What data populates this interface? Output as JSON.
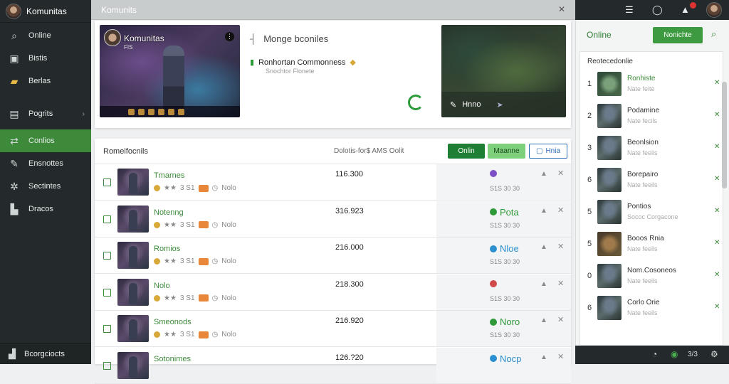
{
  "sidebar": {
    "title": "Komunitas",
    "items": [
      {
        "label": "Online",
        "icon": "search-icon"
      },
      {
        "label": "Bistis",
        "icon": "square-icon"
      },
      {
        "label": "Berlas",
        "icon": "folder-icon"
      },
      {
        "label": "Pogrits",
        "icon": "list-icon"
      },
      {
        "label": "Conlios",
        "icon": "share-icon"
      },
      {
        "label": "Ensnottes",
        "icon": "pen-icon"
      },
      {
        "label": "Sectintes",
        "icon": "gear-icon"
      },
      {
        "label": "Dracos",
        "icon": "chart-icon"
      }
    ],
    "bottom": {
      "label": "Bcorgciocts",
      "icon": "people-icon"
    }
  },
  "topbar": {
    "title": "Komunits"
  },
  "featured": {
    "thumb_title": "Komunitas",
    "thumb_sub": "FIS",
    "heading": "Monge bconiles",
    "stream_title": "Ronhortan Commonness",
    "stream_sub": "Snochtor Flonete",
    "map_label": "Hnno"
  },
  "list": {
    "title": "Romeifocnils",
    "count": "Dolotis-for$ AMS Oolit",
    "buttons": {
      "online": "Onlin",
      "manage": "Maanne",
      "more": "Hnia"
    },
    "rows": [
      {
        "name": "Tmarnes",
        "meta": "3 S1",
        "tag": "Nolo",
        "score": "116.300",
        "status": "",
        "status_color": "#7b4fc7",
        "sub": "S1S 30 30"
      },
      {
        "name": "Notenng",
        "meta": "3 S1",
        "tag": "Nolo",
        "score": "316.923",
        "status": "Pota",
        "status_color": "#2e9a3a",
        "sub": "S1S 30 30"
      },
      {
        "name": "Romios",
        "meta": "3 S1",
        "tag": "Nolo",
        "score": "216.000",
        "status": "Nloe",
        "status_color": "#2b8fd0",
        "sub": "S1S 30 30"
      },
      {
        "name": "Nolo",
        "meta": "3 S1",
        "tag": "Nolo",
        "score": "218.300",
        "status": "",
        "status_color": "#d04a4a",
        "sub": "S1S 30 30"
      },
      {
        "name": "Smeonods",
        "meta": "3 S1",
        "tag": "Nolo",
        "score": "216.920",
        "status": "Noro",
        "status_color": "#2e9a3a",
        "sub": "S1S 30 30"
      },
      {
        "name": "Sotonimes",
        "meta": "",
        "tag": "",
        "score": "126.?20",
        "status": "Nocp",
        "status_color": "#2b8fd0",
        "sub": ""
      }
    ]
  },
  "rightpanel": {
    "online_label": "Online",
    "button": "Nonichte",
    "list_title": "Reotecedonlie",
    "items": [
      {
        "num": "1",
        "title": "Ronhiste",
        "sub": "Nate feite",
        "style": "map",
        "green": true
      },
      {
        "num": "2",
        "title": "Podamine",
        "sub": "Nate fecils",
        "style": "",
        "green": false
      },
      {
        "num": "3",
        "title": "Beonlsion",
        "sub": "Nate feeils",
        "style": "",
        "green": false
      },
      {
        "num": "6",
        "title": "Borepairo",
        "sub": "Nate feeils",
        "style": "",
        "green": false
      },
      {
        "num": "5",
        "title": "Pontios",
        "sub": "Sococ Corgacone",
        "style": "",
        "green": false
      },
      {
        "num": "5",
        "title": "Booos Rnia",
        "sub": "Nate feeils",
        "style": "brown",
        "green": false
      },
      {
        "num": "0",
        "title": "Nom.Cosoneos",
        "sub": "Nate feeils",
        "style": "",
        "green": false
      },
      {
        "num": "6",
        "title": "Corlo Orie",
        "sub": "Nate feeils",
        "style": "",
        "green": false
      }
    ]
  },
  "statusbar": {
    "count": "3/3"
  }
}
